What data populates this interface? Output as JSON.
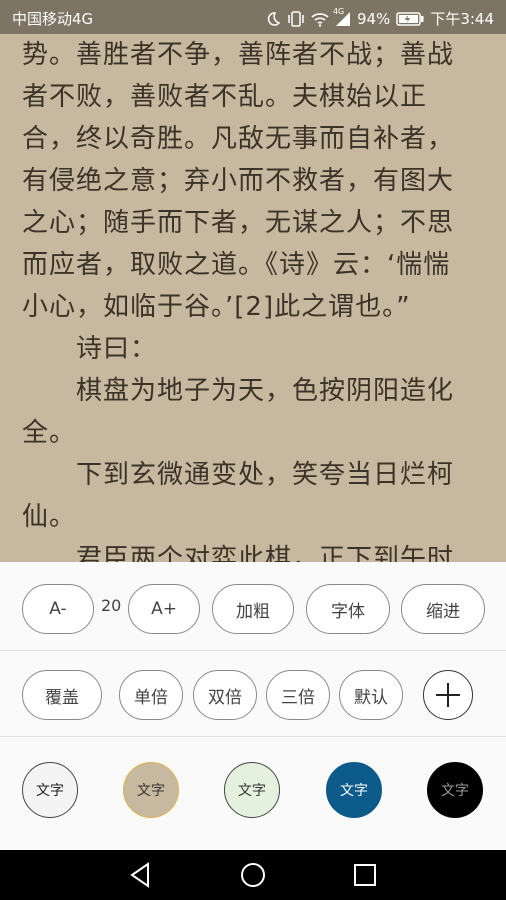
{
  "status_bar": {
    "carrier": "中国移动4G",
    "signal_label": "4G",
    "battery": "94%",
    "time": "下午3:44",
    "icons": [
      "moon-icon",
      "vibrate-icon",
      "wifi-icon",
      "signal-icon",
      "battery-icon"
    ]
  },
  "reader": {
    "lines": [
      "势。善胜者不争，善阵者不战；善战",
      "者不败，善败者不乱。夫棋始以正",
      "合，终以奇胜。凡敌无事而自补者，",
      "有侵绝之意；弃小而不救者，有图大",
      "之心；随手而下者，无谋之人；不思",
      "而应者，取败之道。《诗》云：‘惴惴",
      "小心，如临于谷。’[2]此之谓也。”",
      "　　诗曰：",
      "　　棋盘为地子为天，色按阴阳造化",
      "全。",
      "　　下到玄微通变处，笑夸当日烂柯",
      "仙。",
      "　　君臣两个对弈此棋，正下到午时"
    ]
  },
  "settings": {
    "font_decrease": "A-",
    "font_size": "20",
    "font_increase": "A+",
    "bold": "加粗",
    "font": "字体",
    "indent": "缩进",
    "cover": "覆盖",
    "spacing_single": "单倍",
    "spacing_double": "双倍",
    "spacing_triple": "三倍",
    "spacing_default": "默认",
    "themes": [
      {
        "label": "文字",
        "bg": "#f4f4f4",
        "fg": "#222222",
        "border": "#444444"
      },
      {
        "label": "文字",
        "bg": "#c7b9a0",
        "fg": "#333333",
        "border": "#e0b24a"
      },
      {
        "label": "文字",
        "bg": "#e3f1de",
        "fg": "#333333",
        "border": "#444444"
      },
      {
        "label": "文字",
        "bg": "#0d5b8a",
        "fg": "#ffffff",
        "border": "#0d5b8a"
      },
      {
        "label": "文字",
        "bg": "#000000",
        "fg": "#9a9a9a",
        "border": "#000000"
      }
    ]
  },
  "nav": [
    "back-icon",
    "home-icon",
    "recents-icon"
  ]
}
